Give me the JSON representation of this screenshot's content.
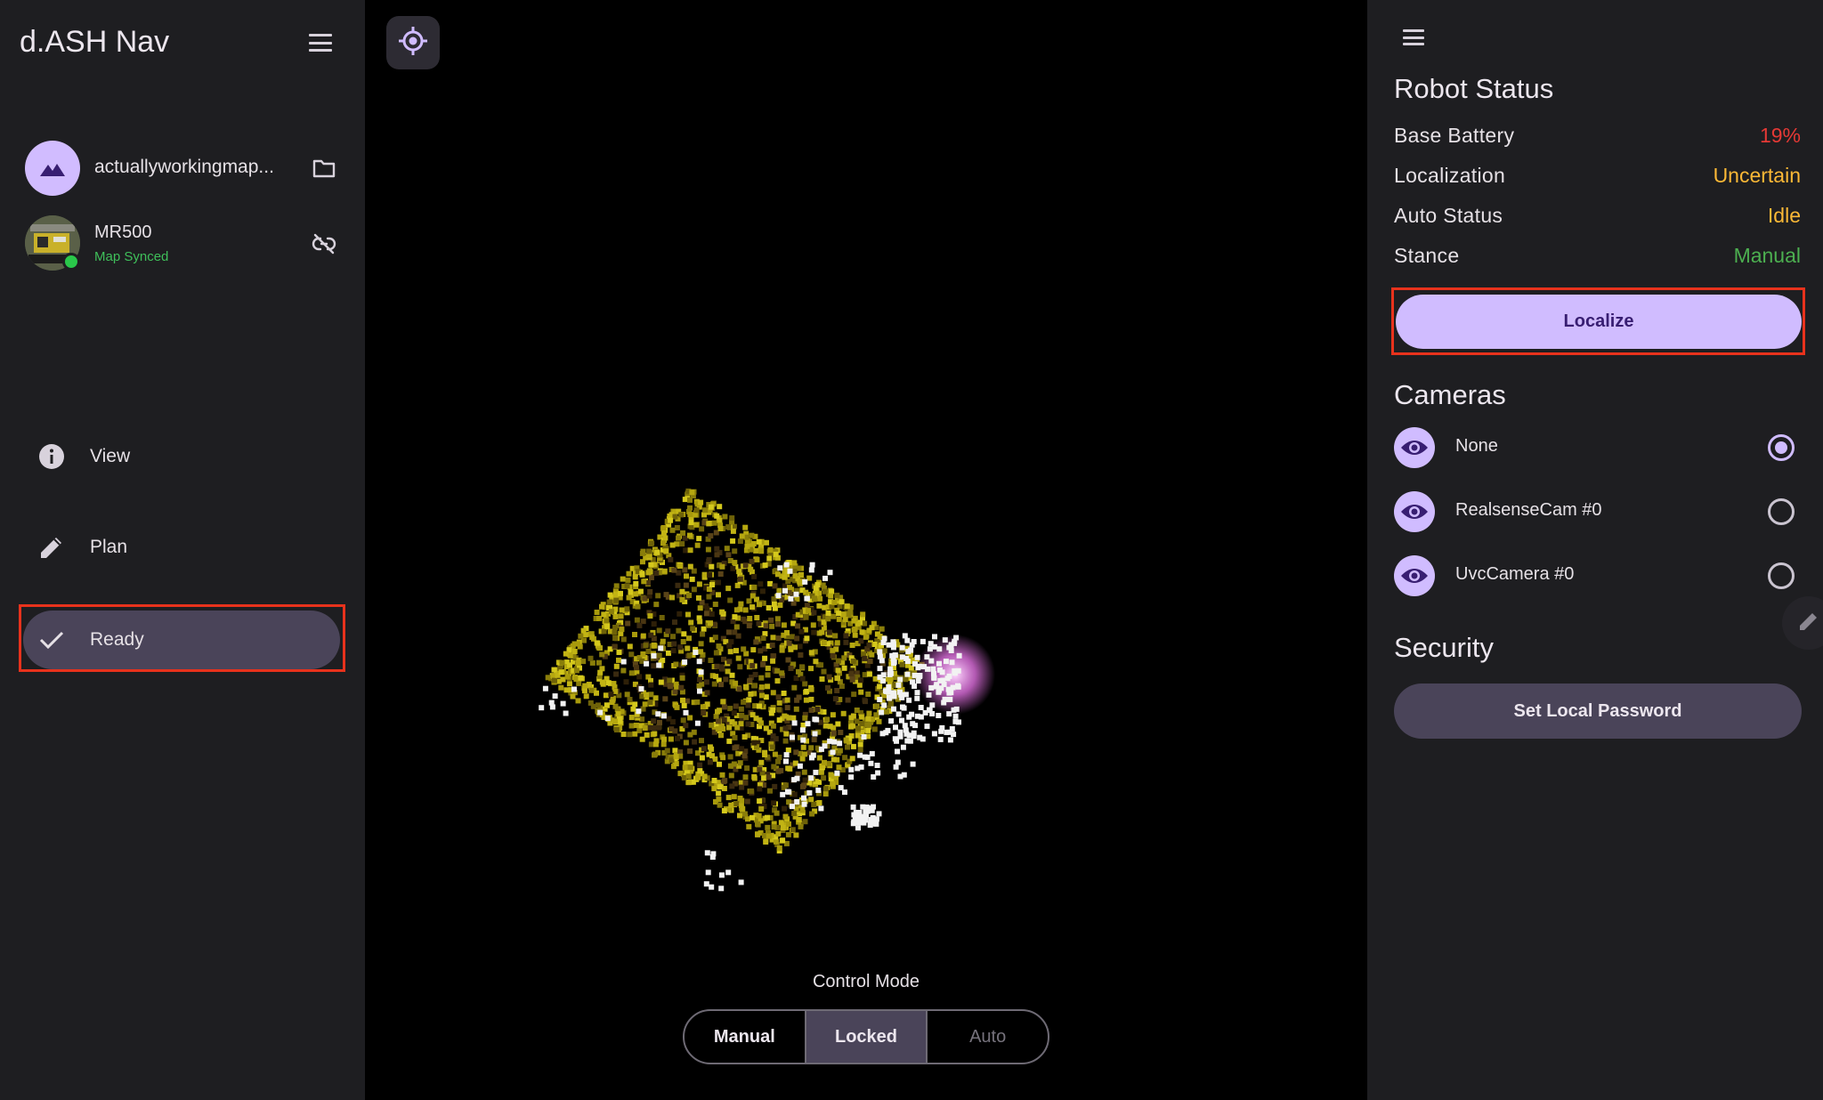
{
  "app": {
    "title": "d.ASH Nav"
  },
  "map": {
    "name": "actuallyworkingmap...",
    "avatar_icon": "terrain-icon",
    "action_icon": "folder-icon"
  },
  "robot": {
    "name": "MR500",
    "status": "Map Synced",
    "status_color": "#3fbf5a",
    "online": true,
    "action_icon": "link-off-icon"
  },
  "nav": {
    "items": [
      {
        "label": "View",
        "icon": "info-icon"
      },
      {
        "label": "Plan",
        "icon": "pencil-icon"
      },
      {
        "label": "Ready",
        "icon": "check-icon",
        "selected": true
      }
    ]
  },
  "control": {
    "label": "Control Mode",
    "modes": [
      {
        "label": "Manual",
        "enabled": true
      },
      {
        "label": "Locked",
        "active": true,
        "enabled": true
      },
      {
        "label": "Auto",
        "enabled": false
      }
    ]
  },
  "robot_status": {
    "title": "Robot Status",
    "rows": [
      {
        "key": "Base Battery",
        "value": "19%",
        "color": "#e53935"
      },
      {
        "key": "Localization",
        "value": "Uncertain",
        "color": "#fbb836"
      },
      {
        "key": "Auto Status",
        "value": "Idle",
        "color": "#fbb836"
      },
      {
        "key": "Stance",
        "value": "Manual",
        "color": "#4caf50"
      }
    ],
    "localize_label": "Localize"
  },
  "cameras": {
    "title": "Cameras",
    "items": [
      {
        "label": "None",
        "selected": true
      },
      {
        "label": "RealsenseCam #0",
        "selected": false
      },
      {
        "label": "UvcCamera #0",
        "selected": false
      }
    ]
  },
  "security": {
    "title": "Security",
    "password_label": "Set Local Password"
  },
  "colors": {
    "accent": "#d0bcff",
    "surface": "#1e1e21",
    "selected": "#4a4459",
    "highlight": "#e8321c"
  }
}
